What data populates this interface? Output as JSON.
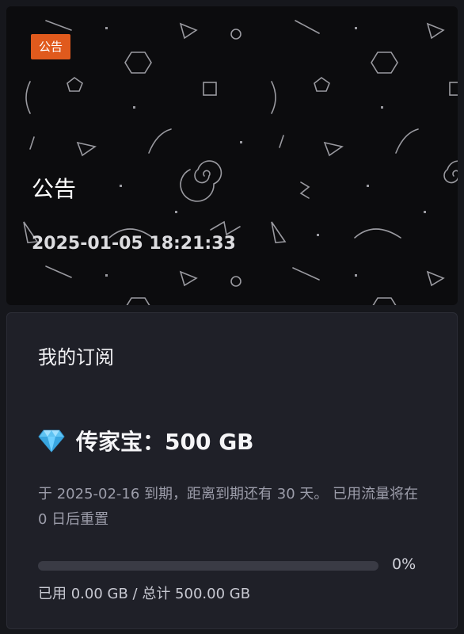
{
  "notice": {
    "tag": "公告",
    "title": "公告",
    "time": "2025-01-05 18:21:33"
  },
  "subscription": {
    "section_title": "我的订阅",
    "plan_icon": "diamond-icon",
    "plan_name": "传家宝：500 GB",
    "description": "于 2025-02-16 到期，距离到期还有 30 天。 已用流量将在 0 日后重置",
    "progress_fraction": 0,
    "percent_label": "0%",
    "usage_text": "已用 0.00 GB / 总计 500.00 GB",
    "accent_color": "#4c7cf0"
  }
}
